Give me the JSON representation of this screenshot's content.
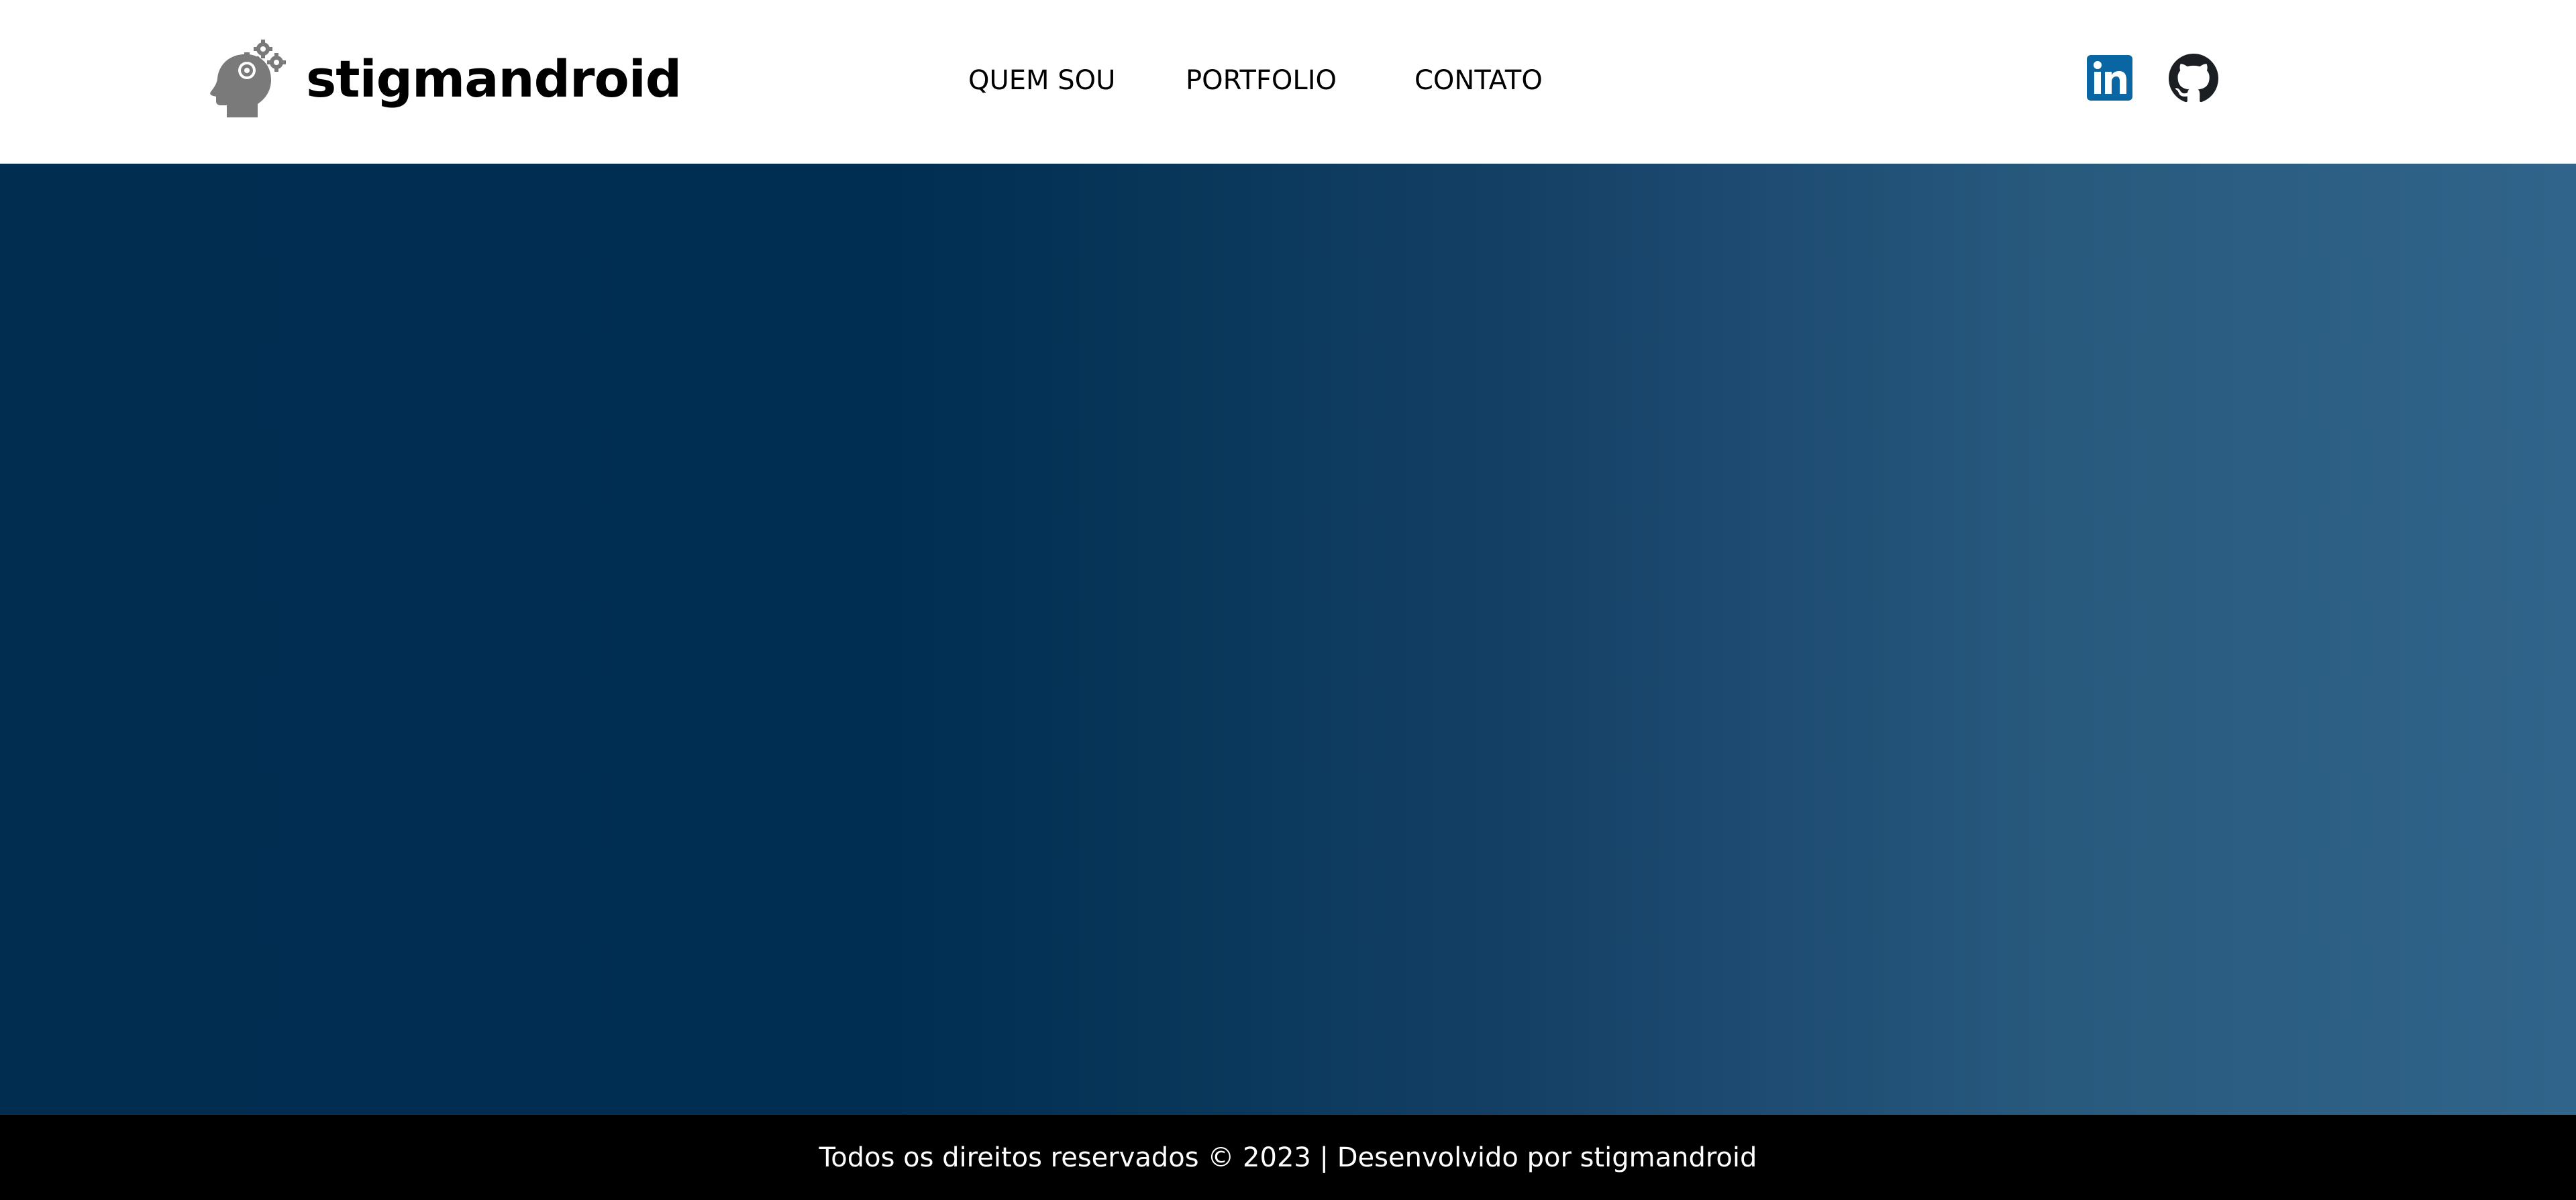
{
  "header": {
    "logo": {
      "icon": "head-gears-icon",
      "text": "stigmandroid"
    },
    "nav": [
      {
        "label": "QUEM SOU"
      },
      {
        "label": "PORTFOLIO"
      },
      {
        "label": "CONTATO"
      }
    ],
    "social": [
      {
        "icon": "linkedin-icon",
        "color": "#0a66a2"
      },
      {
        "icon": "github-icon",
        "color": "#1b1f23"
      }
    ]
  },
  "hero": {
    "gradient_start": "#002d50",
    "gradient_end": "#31648a"
  },
  "footer": {
    "text": "Todos os direitos reservados © 2023 | Desenvolvido por stigmandroid",
    "background": "#000000"
  }
}
